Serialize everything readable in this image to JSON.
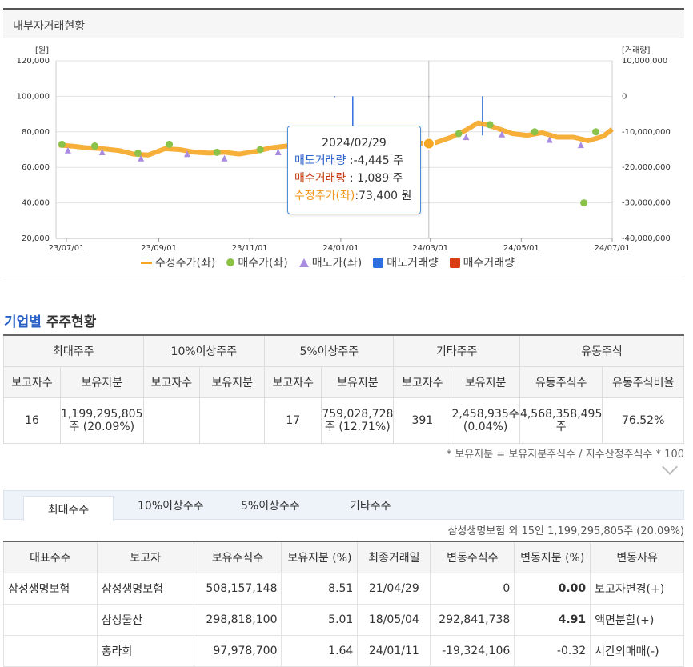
{
  "panel_title": "내부자거래현황",
  "chart_data": {
    "type": "line",
    "left_unit": "[원]",
    "right_unit": "[거래량]",
    "left_ticks": [
      "120,000",
      "100,000",
      "80,000",
      "60,000",
      "40,000",
      "20,000"
    ],
    "left_range": [
      20000,
      120000
    ],
    "right_ticks": [
      "10,000,000",
      "0",
      "-10,000,000",
      "-20,000,000",
      "-30,000,000",
      "-40,000,000"
    ],
    "right_range": [
      -40000000,
      10000000
    ],
    "x_ticks": [
      "23/07/01",
      "23/09/01",
      "23/11/01",
      "24/01/01",
      "24/03/01",
      "24/05/01",
      "24/07/01"
    ],
    "x_range": [
      "2023-06-24",
      "2024-07-01"
    ],
    "series": [
      {
        "name": "수정주가(좌)",
        "color": "#f5a623",
        "x": [
          "2023-06-26",
          "2023-07-05",
          "2023-07-15",
          "2023-07-25",
          "2023-08-05",
          "2023-08-15",
          "2023-08-25",
          "2023-09-05",
          "2023-09-15",
          "2023-09-25",
          "2023-10-05",
          "2023-10-15",
          "2023-10-25",
          "2023-11-05",
          "2023-11-15",
          "2023-11-25",
          "2023-12-05",
          "2023-12-15",
          "2023-12-25",
          "2024-01-05",
          "2024-01-15",
          "2024-01-25",
          "2024-02-05",
          "2024-02-15",
          "2024-02-29",
          "2024-03-05",
          "2024-03-15",
          "2024-03-25",
          "2024-04-02",
          "2024-04-08",
          "2024-04-15",
          "2024-04-25",
          "2024-05-05",
          "2024-05-15",
          "2024-05-25",
          "2024-06-05",
          "2024-06-15",
          "2024-06-25",
          "2024-07-01"
        ],
        "values": [
          72500,
          72000,
          71000,
          70500,
          69500,
          67500,
          67000,
          70500,
          70000,
          68500,
          68000,
          68500,
          67500,
          69000,
          71000,
          72000,
          73000,
          74500,
          75000,
          76000,
          74500,
          73500,
          74500,
          74000,
          73400,
          74000,
          77000,
          81000,
          85000,
          84000,
          82000,
          79000,
          78000,
          79500,
          77000,
          77000,
          75000,
          77500,
          81500
        ]
      },
      {
        "name": "매수가(좌)",
        "color": "#8bc34a",
        "x": [
          "2023-06-28",
          "2023-07-20",
          "2023-08-18",
          "2023-09-08",
          "2023-10-10",
          "2023-11-08",
          "2023-12-12",
          "2024-01-10",
          "2024-02-10",
          "2024-03-20",
          "2024-04-10",
          "2024-05-10",
          "2024-06-12",
          "2024-06-20"
        ],
        "values": [
          73000,
          72000,
          68000,
          73000,
          68500,
          70000,
          74000,
          74500,
          74000,
          79000,
          84000,
          80000,
          40000,
          80000
        ]
      },
      {
        "name": "매도가(좌)",
        "color": "#a98ce0",
        "x": [
          "2023-07-02",
          "2023-07-25",
          "2023-08-20",
          "2023-09-20",
          "2023-10-15",
          "2023-11-20",
          "2023-12-20",
          "2024-01-20",
          "2024-02-20",
          "2024-03-25",
          "2024-04-18",
          "2024-05-20",
          "2024-06-10"
        ],
        "values": [
          71000,
          70000,
          66500,
          69000,
          66500,
          70000,
          73000,
          72500,
          72500,
          78500,
          80000,
          77000,
          74000
        ]
      },
      {
        "name": "매도거래량",
        "color": "#2f6ee0",
        "x": [
          "2023-12-28",
          "2024-01-09",
          "2024-02-29",
          "2024-04-05"
        ],
        "values": [
          -50000,
          -14000000,
          -4445,
          -11000000
        ]
      },
      {
        "name": "매수거래량",
        "color": "#d83c10",
        "x": [],
        "values": []
      }
    ],
    "tooltip": {
      "date": "2024/02/29",
      "sell_label": "매도거래량",
      "sell_value": ":-4,445 주",
      "buy_label": "매수거래량",
      "buy_value": ": 1,089 주",
      "price_label": "수정주가(좌)",
      "price_value": ":73,400 원"
    }
  },
  "section": {
    "title_highlight": "기업별",
    "title_rest": "주주현황"
  },
  "shareholders": {
    "groups": [
      "최대주주",
      "10%이상주주",
      "5%이상주주",
      "기타주주",
      "유동주식"
    ],
    "subheaders": [
      "보고자수",
      "보유지분",
      "보고자수",
      "보유지분",
      "보고자수",
      "보유지분",
      "보고자수",
      "보유지분",
      "유동주식수",
      "유동주식비율"
    ],
    "row": {
      "largest_count": "16",
      "largest_holding": "1,199,295,805 주 (20.09%)",
      "ten_count": "",
      "ten_holding": "",
      "five_count": "17",
      "five_holding": "759,028,728 주 (12.71%)",
      "other_count": "391",
      "other_holding": "2,458,935주 (0.04%)",
      "float_shares": "4,568,358,495 주",
      "float_ratio": "76.52%"
    },
    "note": "* 보유지분 = 보유지분주식수 / 지수산정주식수 * 100"
  },
  "tabs": [
    "최대주주",
    "10%이상주주",
    "5%이상주주",
    "기타주주"
  ],
  "summary": "삼성생명보험 외 15인 1,199,295,805주 (20.09%)",
  "detail": {
    "headers": [
      "대표주주",
      "보고자",
      "보유주식수",
      "보유지분 (%)",
      "최종거래일",
      "변동주식수",
      "변동지분 (%)",
      "변동사유"
    ],
    "rows": [
      {
        "rep": "삼성생명보험",
        "reporter": "삼성생명보험",
        "shares": "508,157,148",
        "pct": "8.51",
        "date": "21/04/29",
        "chg_shares": "0",
        "chg_pct": "0.00",
        "reason": "보고자변경(+)"
      },
      {
        "rep": "",
        "reporter": "삼성물산",
        "shares": "298,818,100",
        "pct": "5.01",
        "date": "18/05/04",
        "chg_shares": "292,841,738",
        "chg_pct": "4.91",
        "reason": "액면분할(+)"
      },
      {
        "rep": "",
        "reporter": "홍라희",
        "shares": "97,978,700",
        "pct": "1.64",
        "date": "24/01/11",
        "chg_shares": "-19,324,106",
        "chg_pct": "-0.32",
        "reason": "시간외매매(-)"
      }
    ]
  }
}
